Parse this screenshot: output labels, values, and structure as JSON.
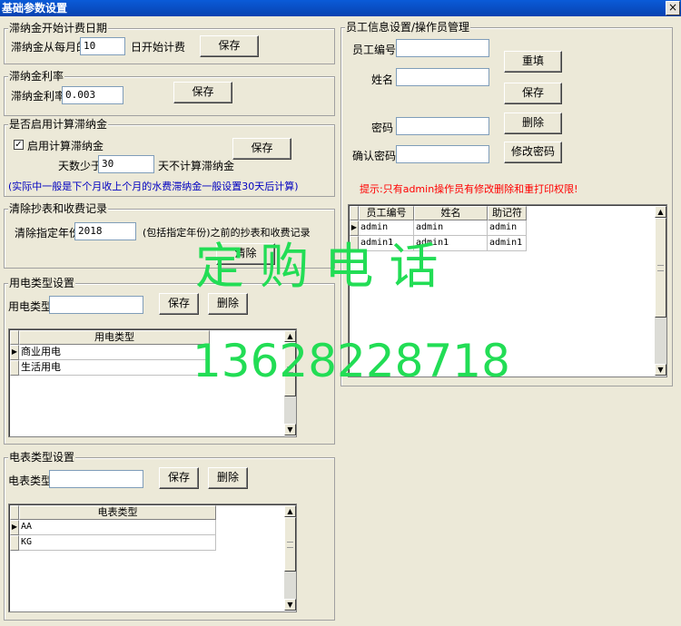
{
  "window": {
    "title": "基础参数设置",
    "close_glyph": "×"
  },
  "late_fee_start": {
    "legend": "滞纳金开始计费日期",
    "prefix": "滞纳金从每月的",
    "day_value": "10",
    "suffix": "日开始计费",
    "save_label": "保存"
  },
  "late_fee_rate": {
    "legend": "滞纳金利率",
    "label": "滞纳金利率",
    "value": "0.003",
    "save_label": "保存"
  },
  "enable_late_fee": {
    "legend": "是否启用计算滞纳金",
    "checkbox_label": "启用计算滞纳金",
    "checked_glyph": "✓",
    "days_prefix": "天数少于",
    "days_value": "30",
    "days_suffix": "天不计算滞纳金",
    "save_label": "保存",
    "note": "(实际中一般是下个月收上个月的水费滞纳金一般设置30天后计算)"
  },
  "clear_records": {
    "legend": "清除抄表和收费记录",
    "label": "清除指定年份",
    "year_value": "2018",
    "description": "(包括指定年份)之前的抄表和收费记录",
    "clear_label": "清除"
  },
  "power_type": {
    "legend": "用电类型设置",
    "label": "用电类型",
    "value": "",
    "save_label": "保存",
    "delete_label": "删除",
    "column": "用电类型",
    "rows": [
      "商业用电",
      "生活用电"
    ]
  },
  "meter_type": {
    "legend": "电表类型设置",
    "label": "电表类型",
    "value": "",
    "save_label": "保存",
    "delete_label": "删除",
    "column": "电表类型",
    "rows": [
      "AA",
      "KG"
    ]
  },
  "employee": {
    "legend": "员工信息设置/操作员管理",
    "id_label": "员工编号",
    "name_label": "姓名",
    "password_label": "密码",
    "confirm_label": "确认密码",
    "id_value": "",
    "name_value": "",
    "password_value": "",
    "confirm_value": "",
    "reset_label": "重填",
    "save_label": "保存",
    "delete_label": "删除",
    "change_pw_label": "修改密码",
    "hint": "提示:只有admin操作员有修改删除和重打印权限!",
    "columns": [
      "员工编号",
      "姓名",
      "助记符"
    ],
    "rows": [
      [
        "admin",
        "admin",
        "admin"
      ],
      [
        "admin1",
        "admin1",
        "admin1"
      ]
    ]
  },
  "watermark": {
    "line1": "定 购 电 话",
    "line2": "13628228718"
  },
  "icons": {
    "row_pointer": "▶",
    "scroll_up": "▲",
    "scroll_down": "▼"
  },
  "colors": {
    "watermark": "#22dd55",
    "note": "#0000c0",
    "hint": "#ff0000",
    "title_bar": "#0a5bd8"
  }
}
